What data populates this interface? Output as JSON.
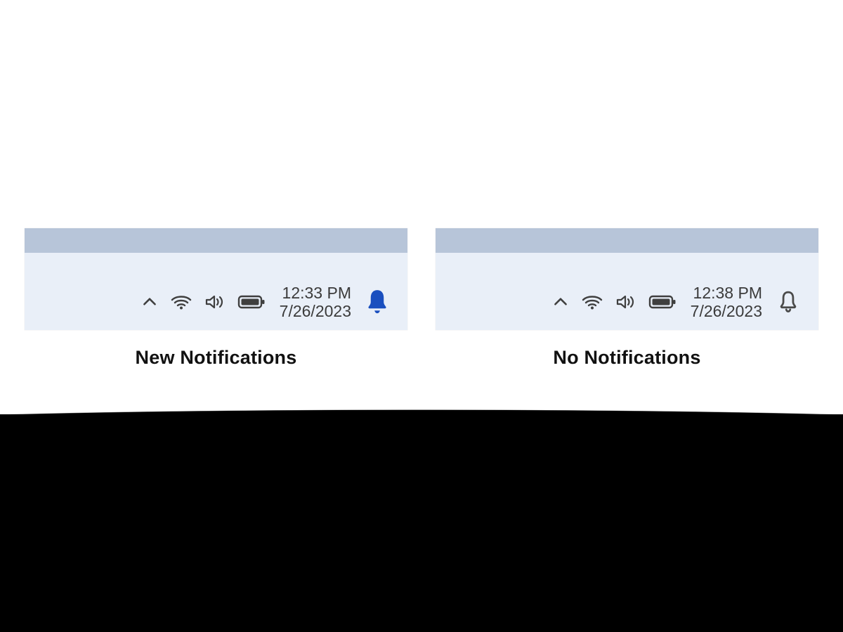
{
  "palette": {
    "taskbar_bg": "#e9eff8",
    "window_strip": "#b7c5d9",
    "icon_stroke": "#3f3f3f",
    "bell_active": "#1a4fbf",
    "bell_inactive_stroke": "#4a4a4a",
    "text": "#3b3b3b"
  },
  "left": {
    "caption": "New Notifications",
    "time": "12:33 PM",
    "date": "7/26/2023",
    "has_notifications": true,
    "icons": {
      "overflow": "chevron-up-icon",
      "wifi": "wifi-icon",
      "sound": "speaker-icon",
      "battery": "battery-icon",
      "bell": "notification-bell-filled-icon"
    }
  },
  "right": {
    "caption": "No Notifications",
    "time": "12:38 PM",
    "date": "7/26/2023",
    "has_notifications": false,
    "icons": {
      "overflow": "chevron-up-icon",
      "wifi": "wifi-icon",
      "sound": "speaker-icon",
      "battery": "battery-icon",
      "bell": "notification-bell-outline-icon"
    }
  }
}
